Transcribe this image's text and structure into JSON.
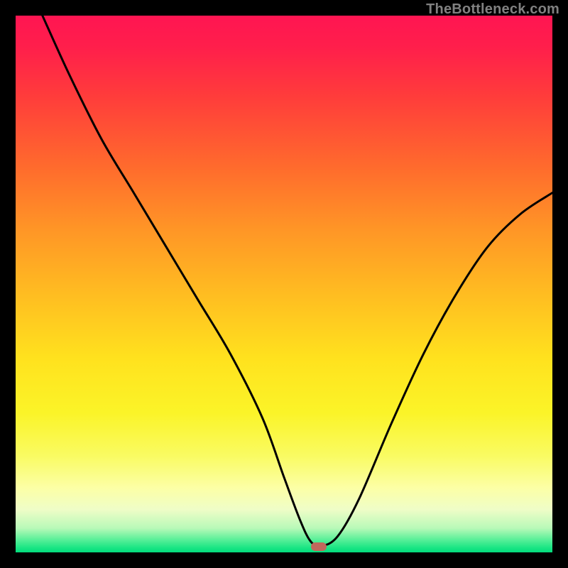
{
  "watermark": "TheBottleneck.com",
  "chart_data": {
    "type": "line",
    "title": "",
    "xlabel": "",
    "ylabel": "",
    "xlim": [
      0,
      100
    ],
    "ylim": [
      0,
      100
    ],
    "grid": false,
    "legend": false,
    "marker": {
      "x": 56.5,
      "y": 1.0,
      "color": "#c1685c"
    },
    "series": [
      {
        "name": "bottleneck-curve",
        "color": "#000000",
        "x": [
          5,
          10,
          16,
          22,
          28,
          34,
          40,
          46,
          50,
          53,
          55,
          57,
          60,
          64,
          70,
          76,
          82,
          88,
          94,
          100
        ],
        "values": [
          100,
          89,
          77,
          67,
          57,
          47,
          37,
          25,
          14,
          6,
          2,
          1.2,
          3,
          10,
          24,
          37,
          48,
          57,
          63,
          67
        ]
      }
    ],
    "background_gradient_stops": [
      {
        "pos": 0,
        "color": "#ff1552"
      },
      {
        "pos": 0.15,
        "color": "#ff3c3b"
      },
      {
        "pos": 0.4,
        "color": "#ff9626"
      },
      {
        "pos": 0.64,
        "color": "#ffe21e"
      },
      {
        "pos": 0.88,
        "color": "#fcffa6"
      },
      {
        "pos": 0.96,
        "color": "#b8f9b8"
      },
      {
        "pos": 1.0,
        "color": "#02db7c"
      }
    ]
  }
}
